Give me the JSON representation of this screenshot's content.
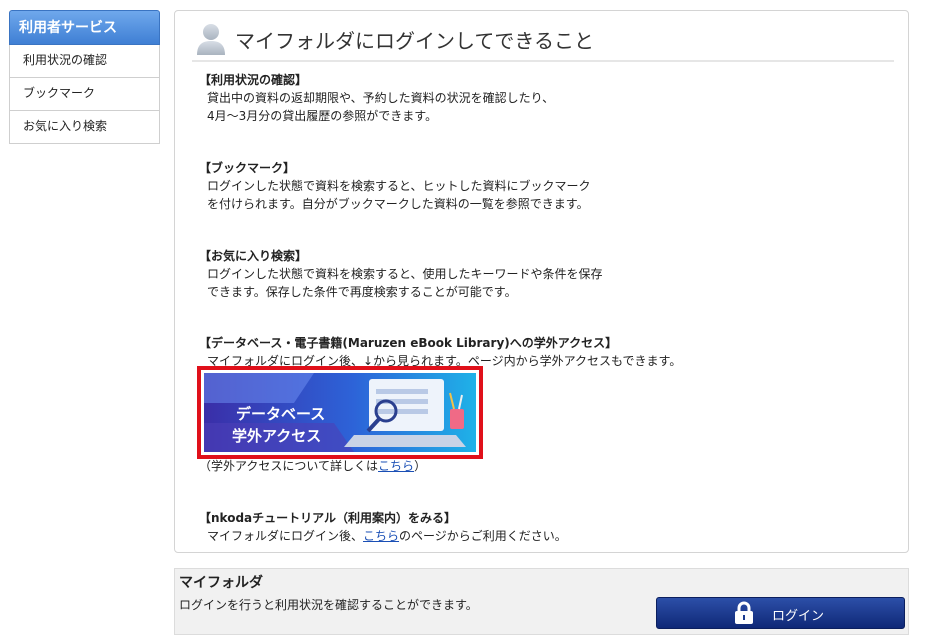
{
  "sidebar": {
    "header": "利用者サービス",
    "items": [
      {
        "label": "利用状況の確認"
      },
      {
        "label": "ブックマーク"
      },
      {
        "label": "お気に入り検索"
      }
    ]
  },
  "panel": {
    "title": "マイフォルダにログインしてできること",
    "sections": [
      {
        "heading": "【利用状況の確認】",
        "body": "貸出中の資料の返却期限や、予約した資料の状況を確認したり、\n4月～3月分の貸出履歴の参照ができます。"
      },
      {
        "heading": "【ブックマーク】",
        "body": "ログインした状態で資料を検索すると、ヒットした資料にブックマーク\nを付けられます。自分がブックマークした資料の一覧を参照できます。"
      },
      {
        "heading": "【お気に入り検索】",
        "body": "ログインした状態で資料を検索すると、使用したキーワードや条件を保存\nできます。保存した条件で再度検索することが可能です。"
      },
      {
        "heading": "【データベース・電子書籍(Maruzen eBook Library)への学外アクセス】",
        "body": "マイフォルダにログイン後、↓から見られます。ページ内から学外アクセスもできます。"
      }
    ],
    "banner": {
      "line1": "データベース",
      "line2": "学外アクセス",
      "caption_prefix": "（学外アクセスについて詳しくは",
      "caption_link": "こちら",
      "caption_suffix": "）"
    },
    "tutorial": {
      "heading": "【nkodaチュートリアル（利用案内）をみる】",
      "body_prefix": "マイフォルダにログイン後、",
      "body_link": "こちら",
      "body_suffix": "のページからご利用ください。"
    }
  },
  "bottom": {
    "title": "マイフォルダ",
    "description": "ログインを行うと利用状況を確認することができます。",
    "login_label": "ログイン"
  },
  "colors": {
    "sidebar_header": "#4f8fe0",
    "banner_border": "#e0101a",
    "login_button": "#1a3a8f",
    "link": "#1a4fb5"
  }
}
